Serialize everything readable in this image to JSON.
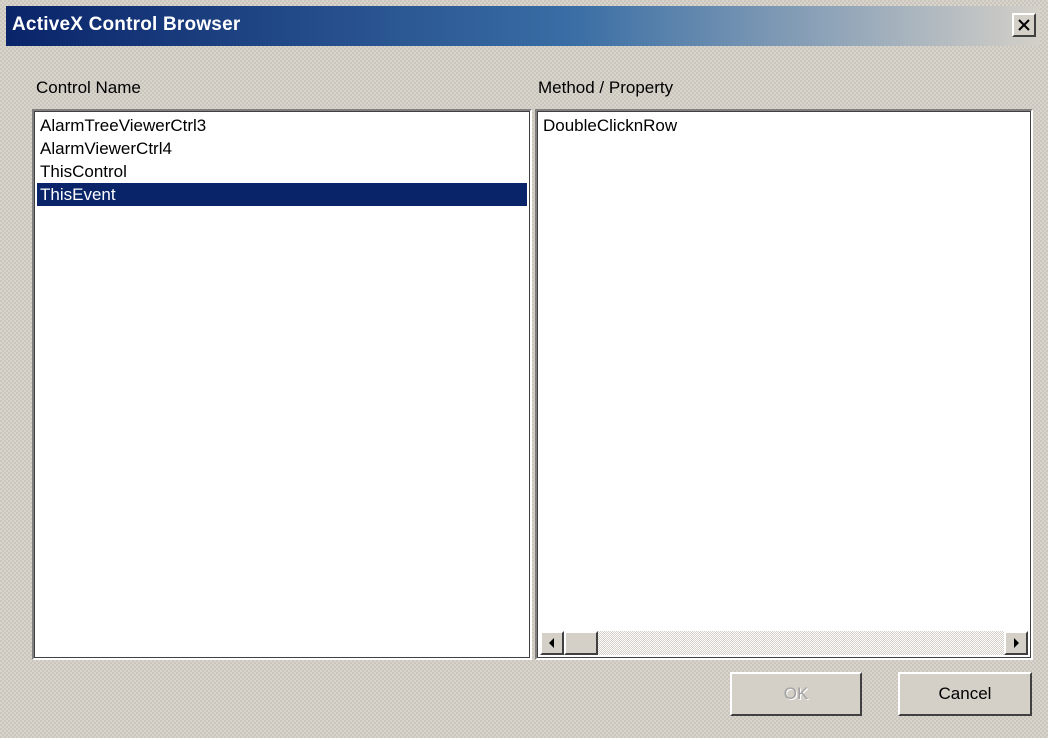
{
  "window": {
    "title": "ActiveX Control Browser"
  },
  "controls": {
    "label": "Control Name",
    "items": [
      {
        "label": "AlarmTreeViewerCtrl3",
        "selected": false
      },
      {
        "label": "AlarmViewerCtrl4",
        "selected": false
      },
      {
        "label": "ThisControl",
        "selected": false
      },
      {
        "label": "ThisEvent",
        "selected": true
      }
    ]
  },
  "methods": {
    "label": "Method / Property",
    "items": [
      {
        "label": "DoubleClicknRow"
      }
    ]
  },
  "buttons": {
    "ok_label": "OK",
    "ok_enabled": false,
    "cancel_label": "Cancel"
  },
  "icons": {
    "close": "close-icon",
    "scroll_left": "arrow-left-icon",
    "scroll_right": "arrow-right-icon"
  },
  "colors": {
    "selection": "#0a246a",
    "title_start": "#0a246a",
    "title_end": "#3a6ea5",
    "face": "#d4d0c8"
  }
}
